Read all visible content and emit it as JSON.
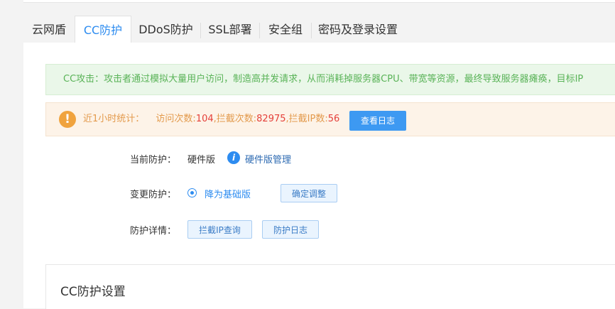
{
  "tabs": [
    {
      "label": "云网盾",
      "active": false
    },
    {
      "label": "CC防护",
      "active": true
    },
    {
      "label": "DDoS防护",
      "active": false
    },
    {
      "label": "SSL部署",
      "active": false
    },
    {
      "label": "安全组",
      "active": false
    },
    {
      "label": "密码及登录设置",
      "active": false
    }
  ],
  "notice": {
    "text": "CC攻击：攻击者通过模拟大量用户访问，制造高并发请求，从而消耗掉服务器CPU、带宽等资源，最终导致服务器瘫痪，目标IP"
  },
  "stats": {
    "prefix": "近1小时统计：",
    "visits_label": "访问次数:",
    "visits": "104",
    "blocked_label": ",拦截次数:",
    "blocked": "82975",
    "blocked_ip_label": ",拦截IP数:",
    "blocked_ip": "56",
    "view_log_label": "查看日志"
  },
  "protection": {
    "current_label": "当前防护：",
    "current_value": "硬件版",
    "manage_link": "硬件版管理",
    "change_label": "变更防护：",
    "downgrade_option": "降为基础版",
    "confirm_label": "确定调整",
    "details_label": "防护详情：",
    "blocked_ip_query": "拦截IP查询",
    "protection_log": "防护日志"
  },
  "settings": {
    "title": "CC防护设置"
  },
  "colors": {
    "accent": "#2d8cf0",
    "success_bg": "#eaf7e9",
    "warn_bg": "#fdf3e8",
    "danger_num": "#e5403a"
  }
}
